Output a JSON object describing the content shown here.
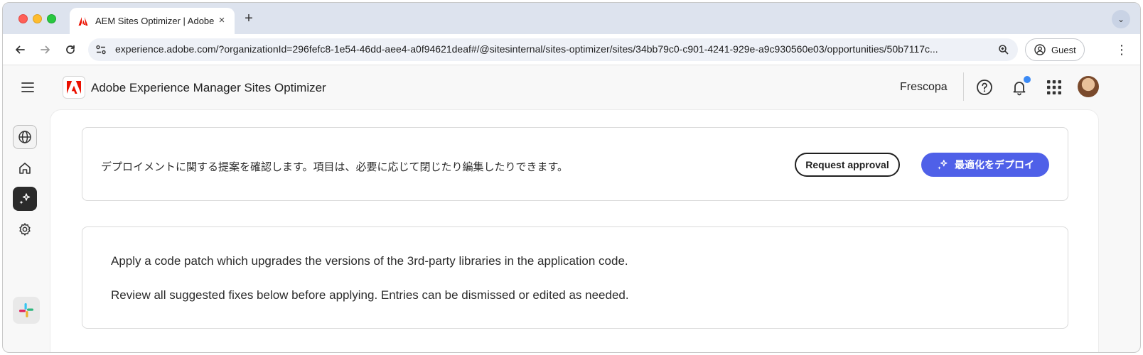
{
  "browser": {
    "tab_title": "AEM Sites Optimizer | Adobe Experience Manager",
    "url": "experience.adobe.com/?organizationId=296fefc8-1e54-46dd-aee4-a0f94621deaf#/@sitesinternal/sites-optimizer/sites/34bb79c0-c901-4241-929e-a9c930560e03/opportunities/50b7117c...",
    "guest_label": "Guest"
  },
  "header": {
    "app_title": "Adobe Experience Manager Sites Optimizer",
    "org_name": "Frescopa"
  },
  "deploy_card": {
    "description": "デプロイメントに関する提案を確認します。項目は、必要に応じて閉じたり編集したりできます。",
    "request_button": "Request approval",
    "deploy_button": "最適化をデプロイ"
  },
  "info_card": {
    "line1": "Apply a code patch which upgrades the versions of the 3rd-party libraries in the application code.",
    "line2": "Review all suggested fixes below before applying. Entries can be dismissed or edited as needed."
  },
  "colors": {
    "accent": "#4f60e8",
    "adobe_red": "#eb1000",
    "notification": "#3b8af5"
  },
  "icons": {
    "rail": [
      "globe-icon",
      "home-icon",
      "sparkle-icon",
      "gear-icon",
      "slack-icon"
    ],
    "header": [
      "help-icon",
      "bell-icon",
      "apps-grid-icon"
    ]
  }
}
